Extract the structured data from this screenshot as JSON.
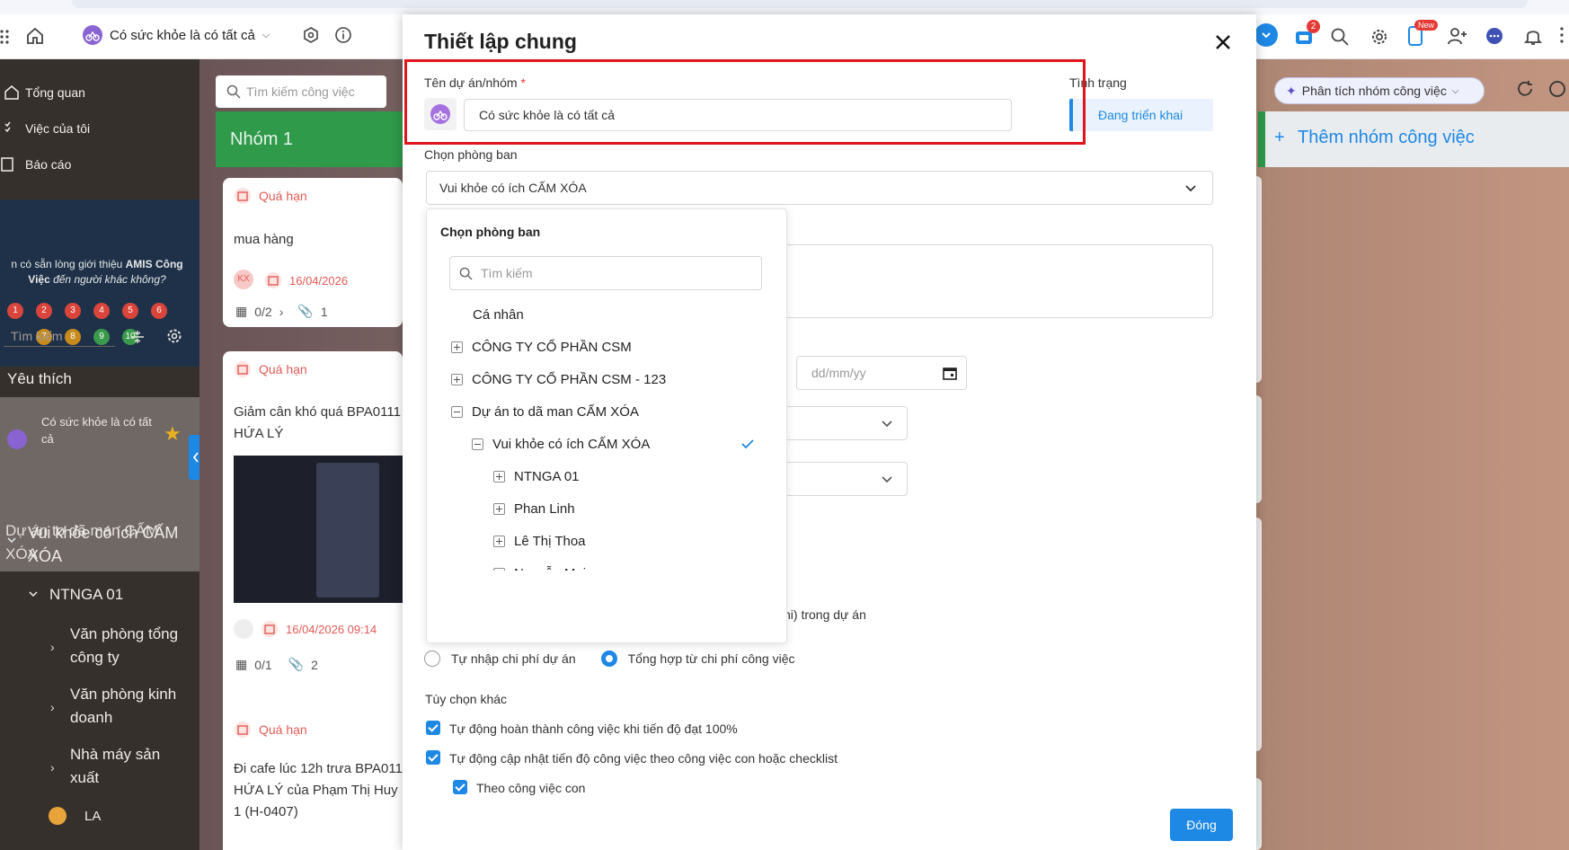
{
  "header": {
    "project_name": "Có sức khỏe là có tất cả",
    "badge_count": "2",
    "new_badge": "New"
  },
  "sidebar": {
    "nav": [
      "Tổng quan",
      "Việc của tôi",
      "Báo cáo"
    ],
    "promo_text_1": "n có sẵn lòng giới thiệu ",
    "promo_brand": "AMIS Công",
    "promo_text_2": "Việc",
    "promo_text_3": " đến người khác không?",
    "rating_row1": [
      "1",
      "2",
      "3",
      "4",
      "5",
      "6"
    ],
    "rating_row2": [
      "7",
      "8",
      "9",
      "10"
    ],
    "search_placeholder": "Tìm kiếm",
    "favorites_title": "Yêu thích",
    "favorite_item": "Có sức khỏe là có tất cả",
    "project_group": "Dự án to dã man CẤM XÓA",
    "tree": {
      "level1": "Vui khỏe có ích CẤM XÓA",
      "level2": "NTNGA 01",
      "level3": [
        "Văn phòng tổng công ty",
        "Văn phòng kinh doanh",
        "Nhà máy sản xuất"
      ],
      "la_item": "LA"
    }
  },
  "board": {
    "search_placeholder": "Tìm kiếm công việc",
    "group_title": "Nhóm 1",
    "overdue_label": "Quá hạn",
    "cards": [
      {
        "title": "mua hàng",
        "avatar": "KX",
        "date": "16/04/2026",
        "subtasks": "0/2",
        "attachments": "1"
      },
      {
        "title_line1": "Giảm cân khó quá BPA0111",
        "title_line2": "HỨA LÝ",
        "date": "16/04/2026 09:14",
        "subtasks": "0/1",
        "attachments": "2"
      },
      {
        "title_line1": "Đi cafe lúc 12h trưa BPA011",
        "title_line2": "HỨA LÝ của Phạm Thị Huy",
        "title_line3": "1 (H-0407)"
      }
    ],
    "analysis_button": "Phân tích nhóm công việc",
    "add_group": "Thêm nhóm công việc"
  },
  "modal": {
    "title": "Thiết lập chung",
    "project_label": "Tên dự án/nhóm",
    "required_mark": "*",
    "project_value": "Có sức khỏe là có tất cả",
    "status_label": "Tình trạng",
    "status_value": "Đang triển khai",
    "department_label": "Chọn phòng ban",
    "department_value": "Vui khỏe có ích CẤM XÓA",
    "date_placeholder": "dd/mm/yy",
    "date_label_fragment": "c",
    "cost_text_fragment": "hi) trong dự án",
    "cost_radio_1": "Tự nhập chi phí dự án",
    "cost_radio_2": "Tổng hợp từ chi phí công việc",
    "other_options_title": "Tùy chọn khác",
    "option_1": "Tự động hoàn thành công việc khi tiến độ đạt 100%",
    "option_2": "Tự động cập nhật tiến độ công việc theo công việc con hoặc checklist",
    "option_2_sub": "Theo công việc con",
    "close_button": "Đóng"
  },
  "dropdown": {
    "title": "Chọn phòng ban",
    "search_placeholder": "Tìm kiếm",
    "items": [
      {
        "label": "Cá nhân"
      },
      {
        "label": "CÔNG TY CỔ PHẦN CSM"
      },
      {
        "label": "CÔNG TY CỔ PHẦN CSM - 123"
      },
      {
        "label": "Dự án to dã man CẤM XÓA"
      },
      {
        "label": "Vui khỏe có ích CẤM XÓA"
      },
      {
        "label": "NTNGA 01"
      },
      {
        "label": "Phan Linh"
      },
      {
        "label": "Lê Thị Thoa"
      },
      {
        "label": "Nguyễn Mai"
      }
    ]
  },
  "colors": {
    "accent": "#1e88e5",
    "sidebar_bg": "#36302c",
    "group_header": "#2e9a4a",
    "overdue": "#e35a54",
    "highlight_box": "#e0141b"
  }
}
